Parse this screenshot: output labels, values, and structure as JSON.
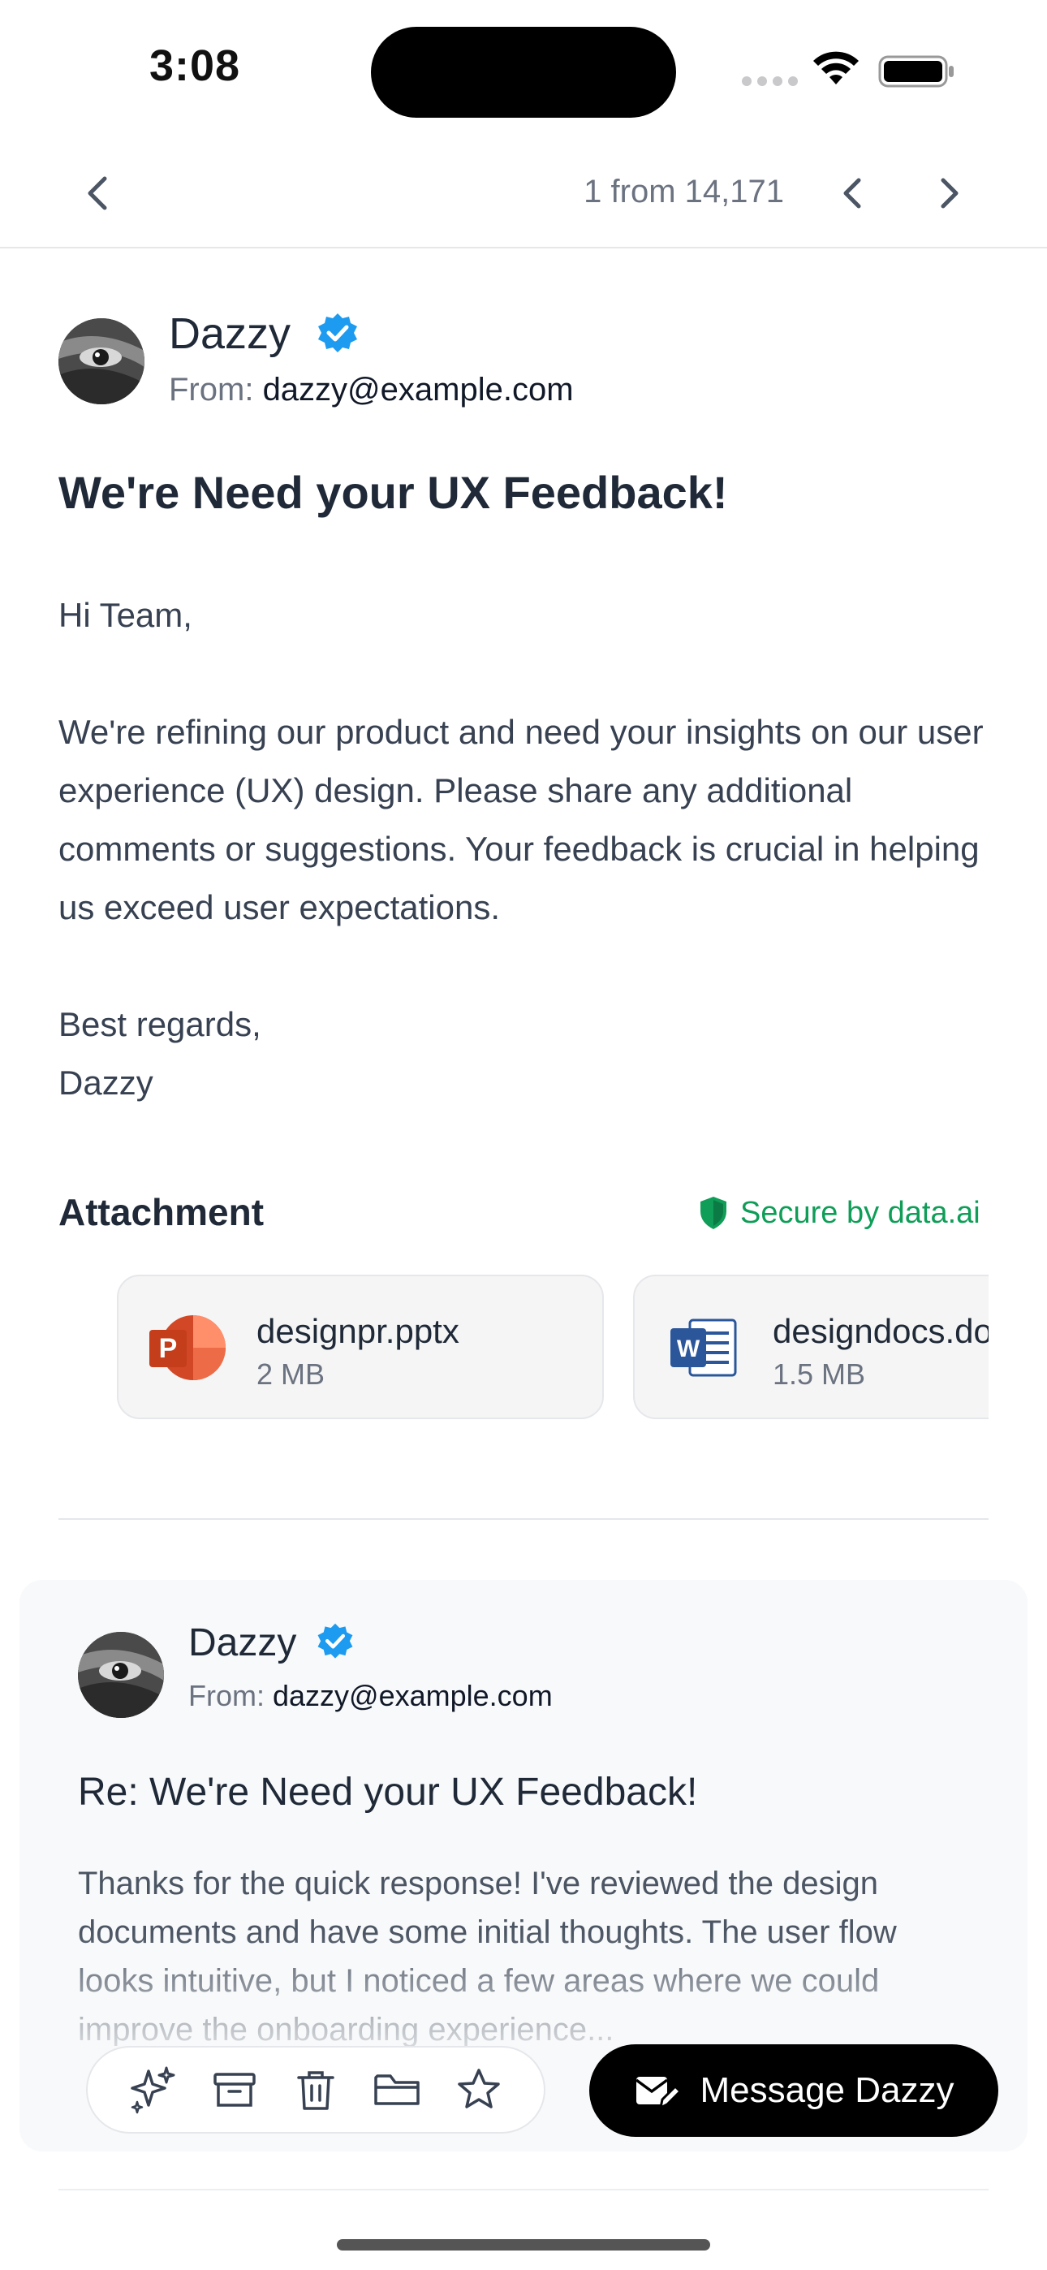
{
  "status_bar": {
    "time": "3:08"
  },
  "nav": {
    "counter": "1 from 14,171"
  },
  "email": {
    "sender_name": "Dazzy",
    "from_label": "From:",
    "from_email": "dazzy@example.com",
    "subject": "We're Need your UX Feedback!",
    "greeting": "Hi Team,",
    "paragraph": "We're refining our product and need your insights on our user experience (UX) design. Please share any additional comments or suggestions. Your feedback is crucial in helping us exceed user expectations.",
    "closing": "Best regards,",
    "signature": "Dazzy"
  },
  "attachments": {
    "title": "Attachment",
    "secure_label": "Secure by data.ai",
    "items": [
      {
        "name": "designpr.pptx",
        "size": "2 MB",
        "icon": "powerpoint-icon"
      },
      {
        "name": "designdocs.docx",
        "size": "1.5 MB",
        "icon": "word-icon"
      }
    ]
  },
  "reply": {
    "sender_name": "Dazzy",
    "from_label": "From:",
    "from_email": "dazzy@example.com",
    "subject": "Re: We're Need your UX Feedback!",
    "body": "Thanks for the quick response! I've reviewed the design documents and have some initial thoughts. The user flow looks intuitive, but I noticed a few areas where we could improve the onboarding experience..."
  },
  "toolbar": {
    "icons": [
      "sparkles-icon",
      "archive-icon",
      "trash-icon",
      "folder-icon",
      "star-icon"
    ],
    "message_button_label": "Message Dazzy"
  },
  "colors": {
    "accent_verified": "#1d9bf0",
    "secure_green": "#0f9d58",
    "button_black": "#000000"
  }
}
